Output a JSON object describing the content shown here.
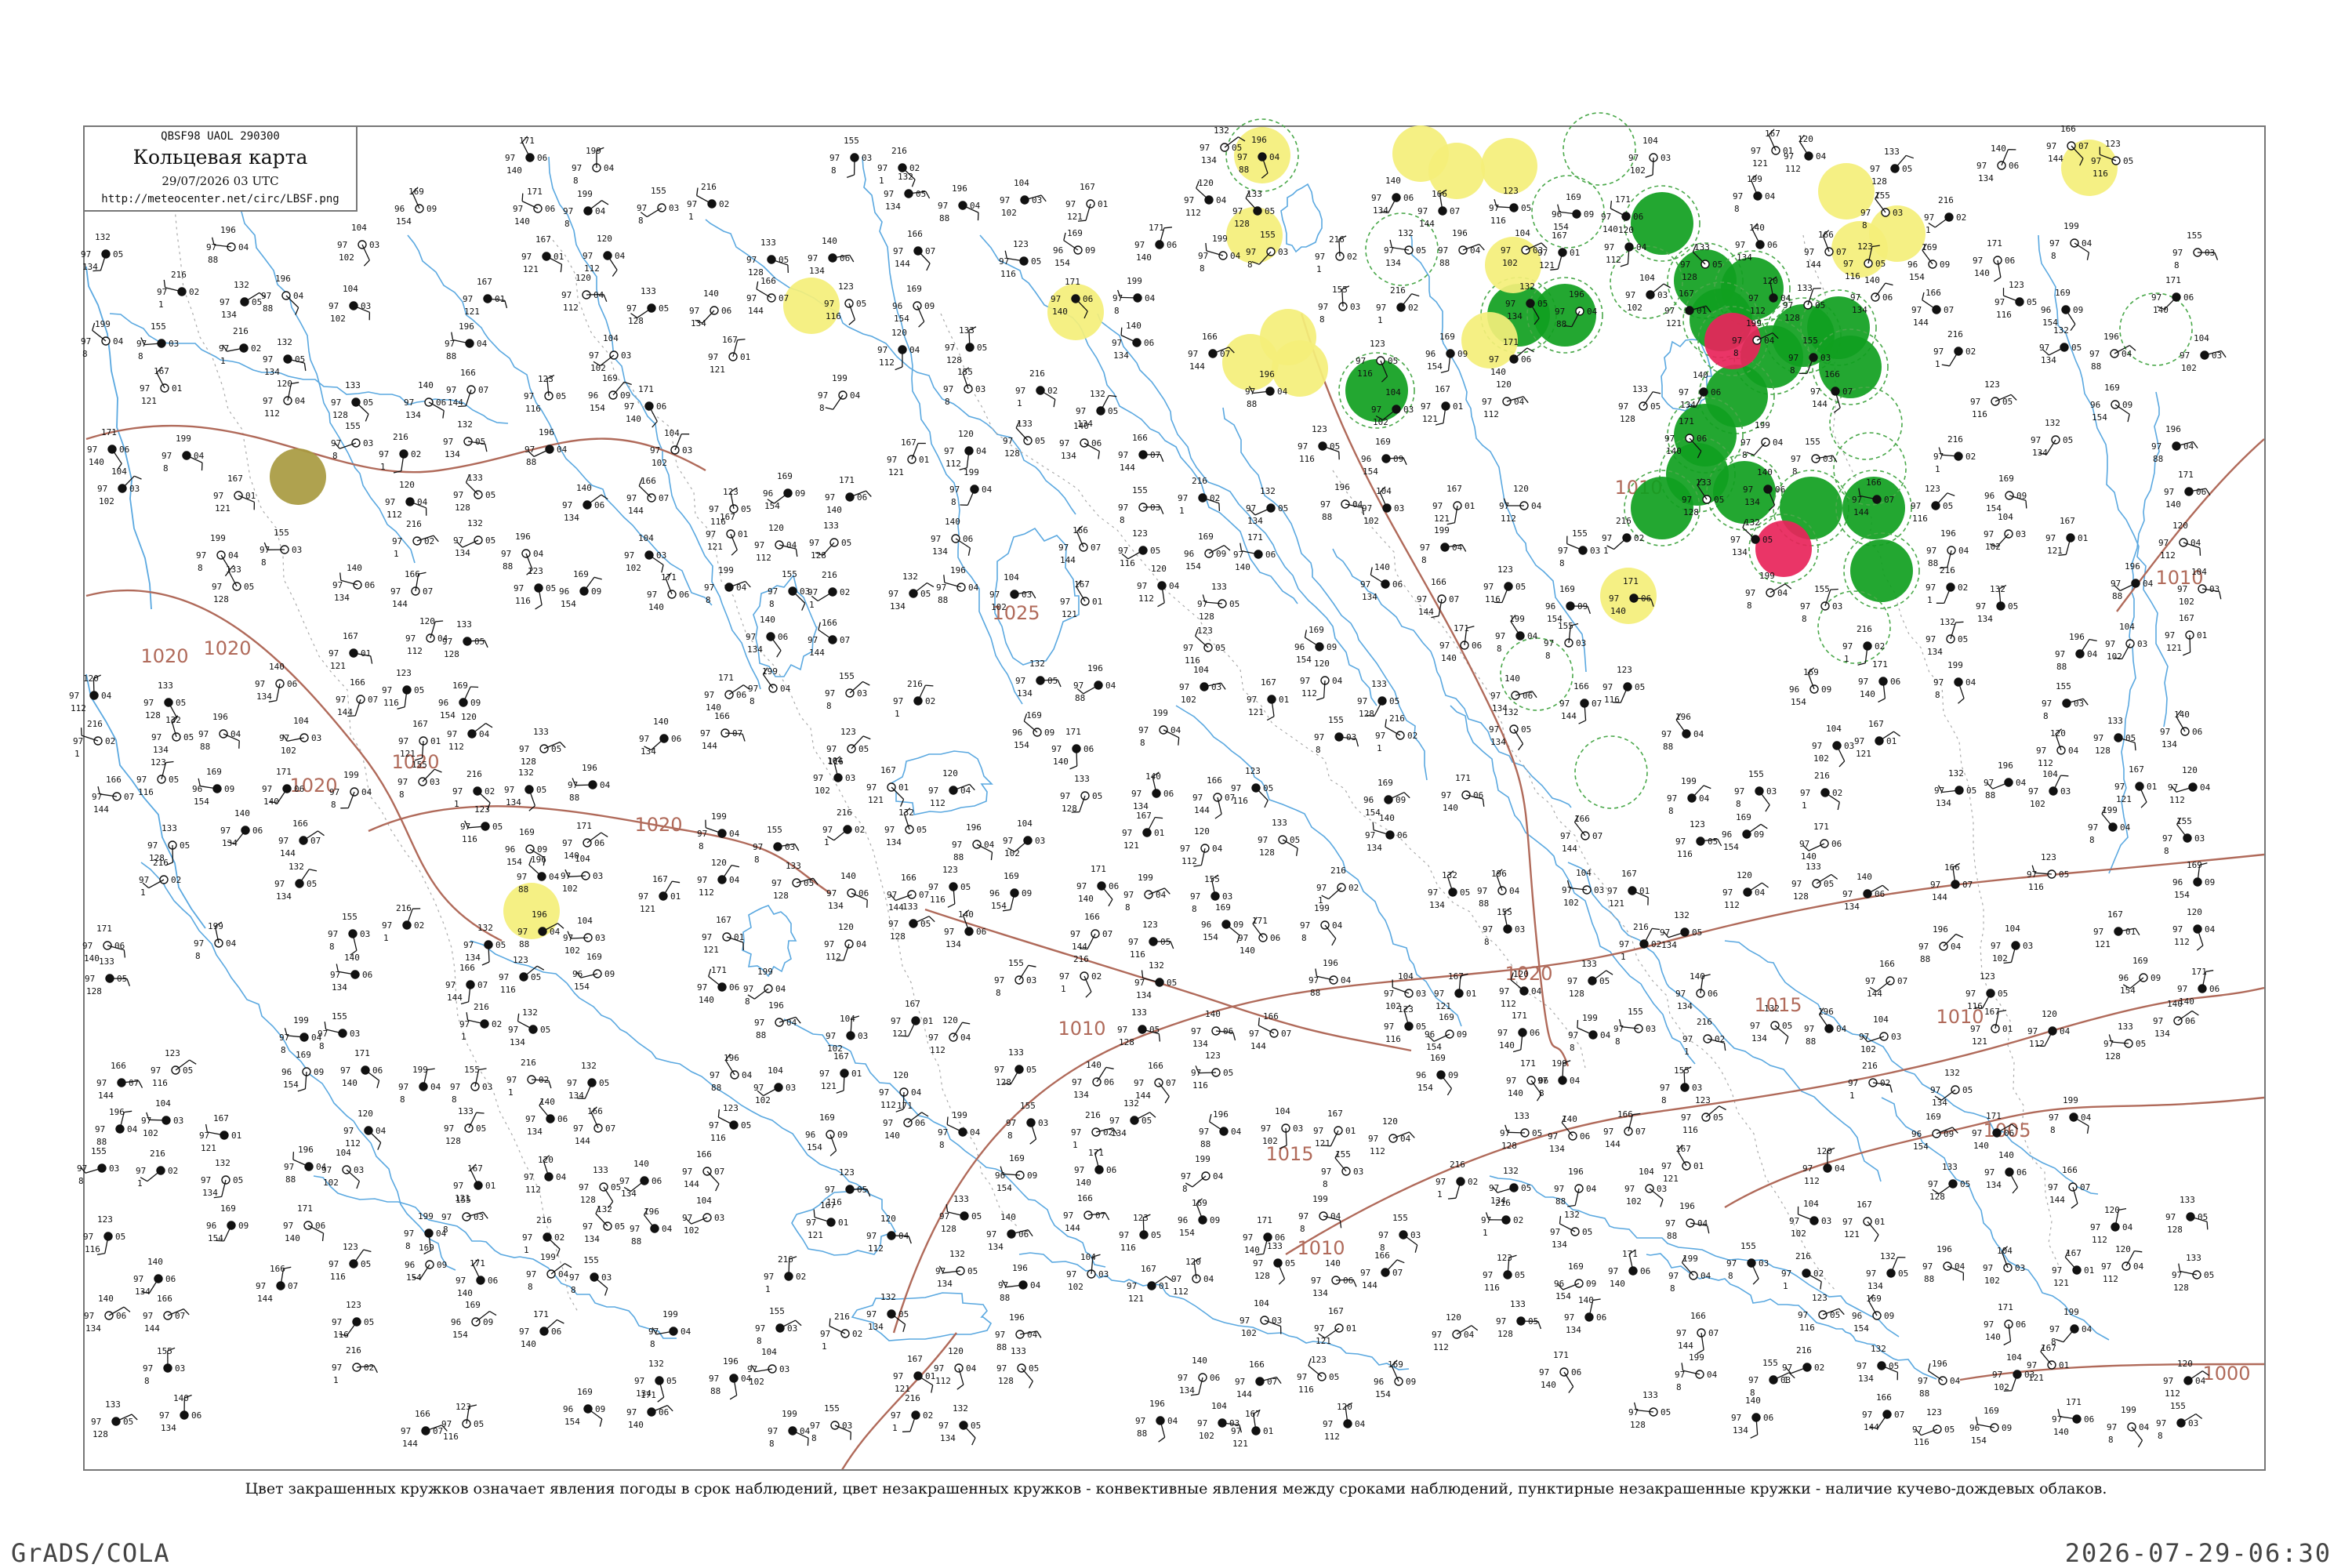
{
  "header": {
    "bulletin": "QBSF98  UAOL  290300",
    "title": "Кольцевая карта",
    "date": "29/07/2026 03 UTC",
    "url": "http://meteocenter.net/circ/LBSF.png"
  },
  "caption": "Цвет закрашенных кружков означает явления погоды в срок наблюдений, цвет незакрашенных кружков - конвективные явления между сроками наблюдений, пунктирные незакрашенные кружки - наличие кучево-дождевых облаков.",
  "footer": {
    "left": "GrADS/COLA",
    "right": "2026-07-29-06:30"
  },
  "colors": {
    "isobar": "#b06a5a",
    "river": "#5aa8e0",
    "coast": "#5aa8e0",
    "border": "#aaaaaa",
    "station_text": "#111111",
    "precip": "#10a020",
    "haze": "#f4ef7a",
    "thunder": "#e8245a",
    "fog": "#a89a40",
    "cb_dashed": "#4aa84a"
  },
  "isobar_labels": [
    "1025",
    "1020",
    "1020",
    "1020",
    "1020",
    "1020",
    "1020",
    "1015",
    "1015",
    "1010",
    "1010",
    "1010",
    "1010",
    "1010",
    "1005",
    "1000",
    "1000"
  ],
  "station_samples": [
    {
      "top": "171",
      "mid": "97",
      "bottom": "140",
      "code": "06"
    },
    {
      "top": "199",
      "mid": "97",
      "bottom": "8",
      "code": "04"
    },
    {
      "top": "155",
      "mid": "97",
      "bottom": "8",
      "code": "03"
    },
    {
      "top": "216",
      "mid": "97",
      "bottom": "1",
      "code": "02"
    },
    {
      "top": "132",
      "mid": "97",
      "bottom": "134",
      "code": "05"
    },
    {
      "top": "196",
      "mid": "97",
      "bottom": "88",
      "code": "04"
    },
    {
      "top": "104",
      "mid": "97",
      "bottom": "102",
      "code": "03"
    },
    {
      "top": "167",
      "mid": "97",
      "bottom": "121",
      "code": "01"
    },
    {
      "top": "120",
      "mid": "97",
      "bottom": "112",
      "code": "04"
    },
    {
      "top": "133",
      "mid": "97",
      "bottom": "128",
      "code": "05"
    },
    {
      "top": "140",
      "mid": "97",
      "bottom": "134",
      "code": "06"
    },
    {
      "top": "166",
      "mid": "97",
      "bottom": "144",
      "code": "07"
    },
    {
      "top": "123",
      "mid": "97",
      "bottom": "116",
      "code": "05"
    },
    {
      "top": "169",
      "mid": "96",
      "bottom": "154",
      "code": "09"
    }
  ]
}
